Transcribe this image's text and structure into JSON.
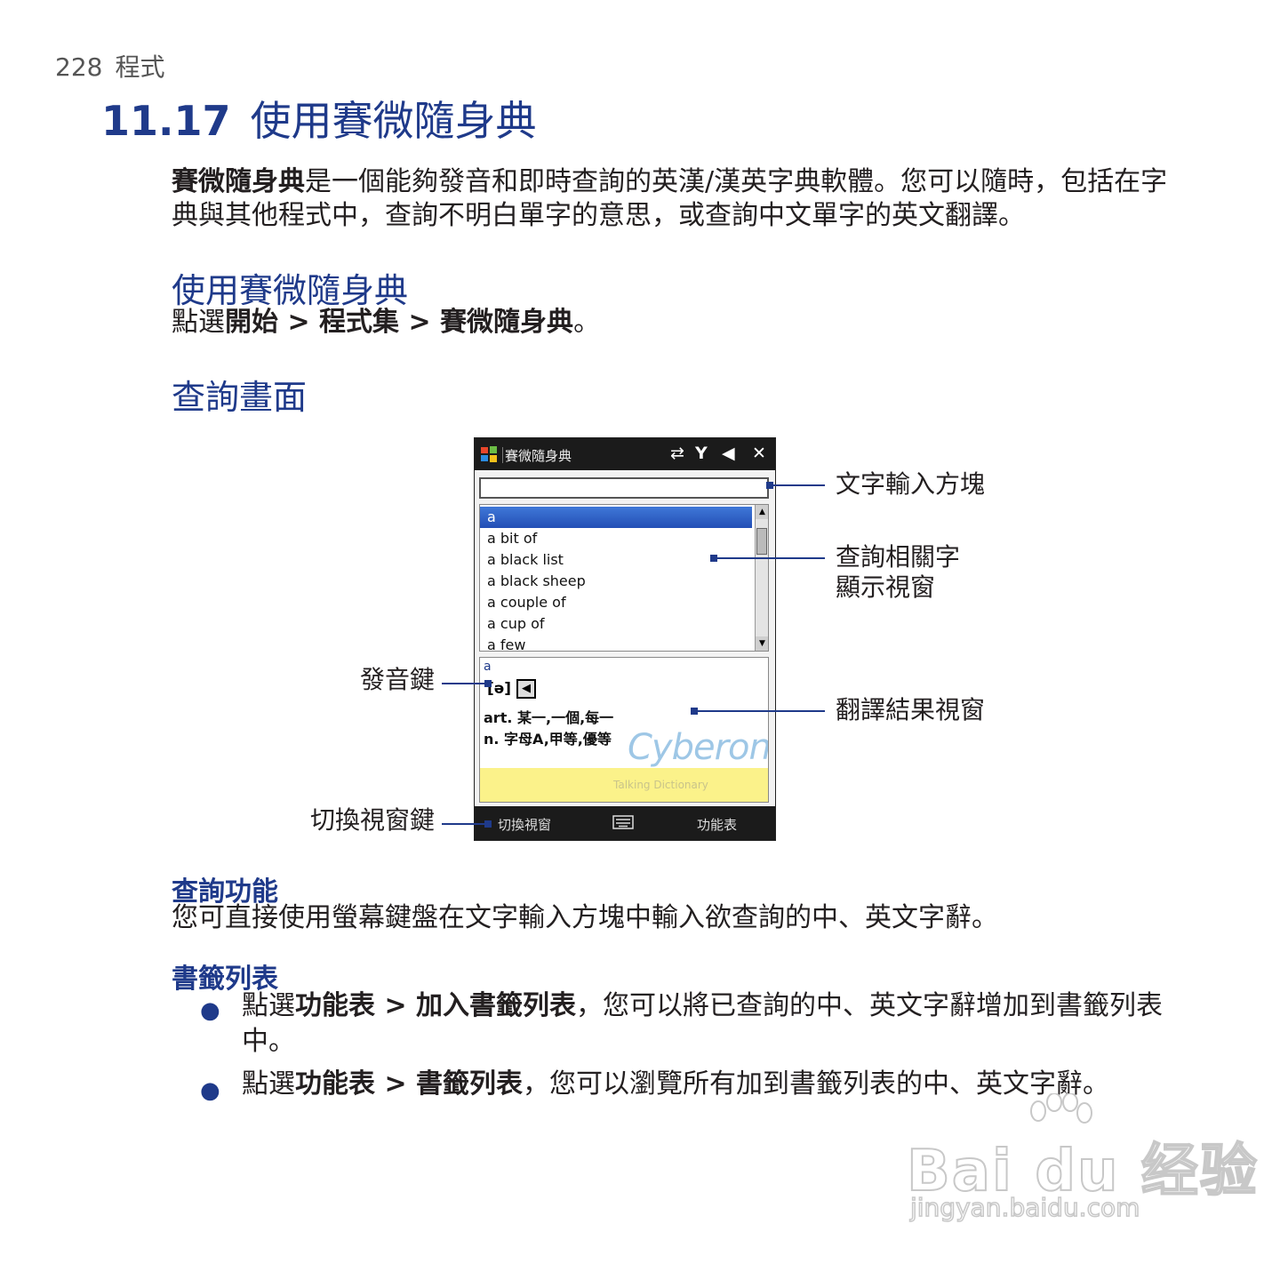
{
  "running_head": {
    "page_number": "228",
    "section": "程式"
  },
  "chapter": {
    "number": "11.17",
    "title": "使用賽微隨身典"
  },
  "intro": {
    "bold": "賽微隨身典",
    "text": "是一個能夠發音和即時查詢的英漢/漢英字典軟體。您可以隨時，包括在字典與其他程式中，查詢不明白單字的意思，或查詢中文單字的英文翻譯。"
  },
  "section_use": {
    "heading": "使用賽微隨身典",
    "tap": "點選",
    "start": "開始",
    "sep1": " > ",
    "programs": "程式集",
    "sep2": " > ",
    "app": "賽微隨身典",
    "end": "。"
  },
  "section_query_screen": {
    "heading": "查詢畫面"
  },
  "device": {
    "title": "賽微隨身典",
    "status_icons": [
      "sync-icon",
      "signal-icon",
      "volume-icon",
      "close-icon"
    ],
    "status_glyphs": {
      "sync": "⇄",
      "signal": "Y",
      "volume": "◀",
      "close": "✕"
    },
    "word_list": [
      "a",
      "a bit of",
      "a black list",
      "a black sheep",
      "a couple of",
      "a cup of",
      "a few"
    ],
    "result": {
      "word": "a",
      "phonetic": "[ə]",
      "definitions": [
        "art. 某一,一個,每一",
        "n. 字母A,甲等,優等"
      ],
      "brand": "Cyberon",
      "tagline": "Talking Dictionary"
    },
    "softkey_left": "切換視窗",
    "softkey_middle_icon": "keyboard-icon",
    "softkey_right": "功能表"
  },
  "callouts": {
    "input": "文字輸入方塊",
    "related_line1": "查詢相關字",
    "related_line2": "顯示視窗",
    "pronounce": "發音鍵",
    "result": "翻譯結果視窗",
    "switch": "切換視窗鍵"
  },
  "section_query_function": {
    "heading": "查詢功能",
    "text": "您可直接使用螢幕鍵盤在文字輸入方塊中輸入欲查詢的中、英文字辭。"
  },
  "section_bookmarks": {
    "heading": "書籤列表",
    "items": [
      {
        "tap": "點選",
        "path": "功能表 > 加入書籤列表",
        "text": "，您可以將已查詢的中、英文字辭增加到書籤列表中。"
      },
      {
        "tap": "點選",
        "path": "功能表 > 書籤列表",
        "text": "，您可以瀏覽所有加到書籤列表的中、英文字辭。"
      }
    ]
  },
  "watermark": {
    "text": "Bai du 经验",
    "url": "jingyan.baidu.com"
  },
  "colors": {
    "heading_blue": "#1f3a8a",
    "body_text": "#231f20",
    "highlight": "#3f78d8",
    "banner_yellow": "#fbf28a"
  }
}
